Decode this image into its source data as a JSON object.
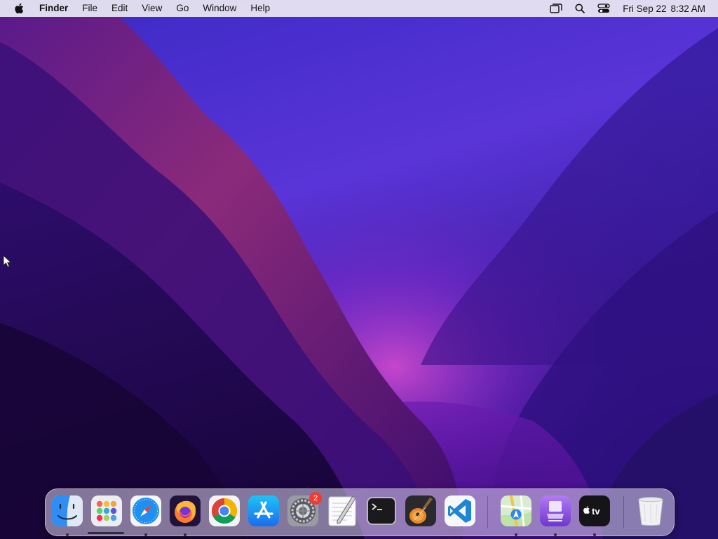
{
  "menubar": {
    "apple_icon": "apple-logo-icon",
    "app_name": "Finder",
    "menus": [
      "File",
      "Edit",
      "View",
      "Go",
      "Window",
      "Help"
    ],
    "status_icons": [
      "screen-mirroring-icon",
      "spotlight-search-icon",
      "control-center-icon"
    ],
    "date": "Fri Sep 22",
    "time": "8:32 AM"
  },
  "dock": {
    "items": [
      {
        "name": "Finder",
        "icon": "finder-icon",
        "running": true
      },
      {
        "name": "Launchpad",
        "icon": "launchpad-icon",
        "running": false
      },
      {
        "name": "Safari",
        "icon": "safari-icon",
        "running": true
      },
      {
        "name": "Firefox",
        "icon": "firefox-icon",
        "running": true
      },
      {
        "name": "Google Chrome",
        "icon": "chrome-icon",
        "running": false
      },
      {
        "name": "App Store",
        "icon": "app-store-icon",
        "running": false
      },
      {
        "name": "System Settings",
        "icon": "system-settings-icon",
        "running": false,
        "badge": "2"
      },
      {
        "name": "TextEdit",
        "icon": "textedit-icon",
        "running": false
      },
      {
        "name": "Terminal",
        "icon": "terminal-icon",
        "running": false
      },
      {
        "name": "GarageBand",
        "icon": "garageband-icon",
        "running": false
      },
      {
        "name": "Visual Studio Code",
        "icon": "vscode-icon",
        "running": false
      },
      {
        "name": "Maps",
        "icon": "maps-icon",
        "running": true
      },
      {
        "name": "Apple Configurator",
        "icon": "apple-configurator-icon",
        "running": true
      },
      {
        "name": "TV",
        "icon": "apple-tv-icon",
        "running": true
      },
      {
        "name": "Trash",
        "icon": "trash-icon",
        "running": false
      }
    ]
  },
  "colors": {
    "wallpaper_top": "#3a21b8",
    "wallpaper_bottom": "#1c0645",
    "wallpaper_accent": "#c42f9c",
    "badge_red": "#f23b30"
  }
}
